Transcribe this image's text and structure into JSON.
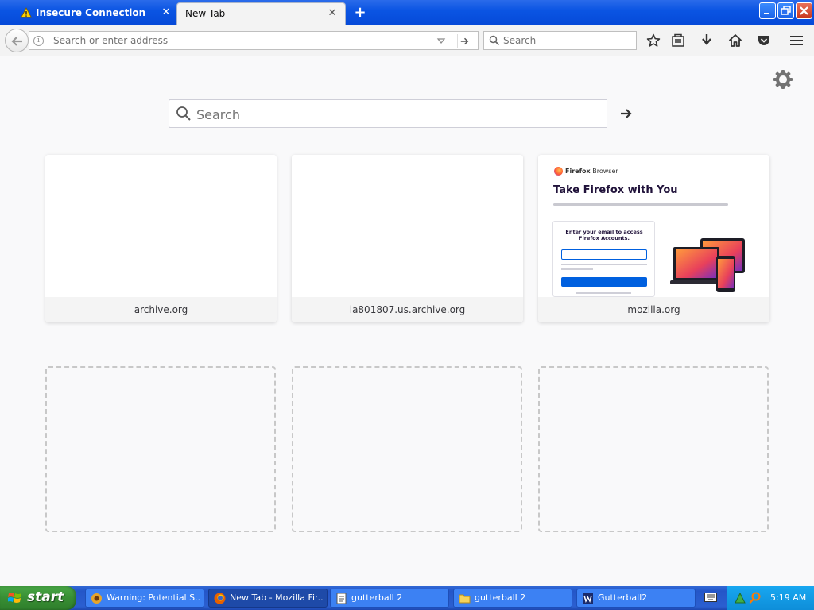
{
  "browser": {
    "tabs": [
      {
        "label": "Insecure Connection",
        "icon": "warning-icon",
        "active": false
      },
      {
        "label": "New Tab",
        "active": true
      }
    ],
    "new_tab_icon": "plus-icon",
    "window_controls": [
      "minimize-icon",
      "restore-icon",
      "close-icon"
    ],
    "urlbar": {
      "placeholder": "Search or enter address",
      "value": ""
    },
    "searchbar": {
      "placeholder": "Search"
    },
    "toolbar_icons": [
      "bookmark-star-icon",
      "library-icon",
      "download-icon",
      "home-icon",
      "pocket-icon",
      "menu-icon"
    ]
  },
  "newtab": {
    "search_placeholder": "Search",
    "settings_icon": "gear-icon",
    "top_sites": [
      {
        "label": "archive.org"
      },
      {
        "label": "ia801807.us.archive.org"
      },
      {
        "label": "mozilla.org"
      }
    ],
    "empty_slots": 3,
    "preview": {
      "brand_bold": "Firefox",
      "brand_rest": "Browser",
      "title": "Take Firefox with You",
      "card_heading": "Enter your email to access Firefox Accounts."
    }
  },
  "taskbar": {
    "start_label": "start",
    "tasks": [
      {
        "label": "Warning: Potential S...",
        "icon": "warning-app-icon",
        "active": false
      },
      {
        "label": "New Tab - Mozilla Fir...",
        "icon": "firefox-icon",
        "active": true
      },
      {
        "label": "gutterball 2",
        "icon": "notepad-icon",
        "active": false
      },
      {
        "label": "gutterball 2",
        "icon": "folder-icon",
        "active": false
      },
      {
        "label": "Gutterball2",
        "icon": "game-icon",
        "active": false
      }
    ],
    "clock": "5:19 AM"
  },
  "colors": {
    "titlebar": "#0b55e3",
    "taskbar": "#2456c8",
    "start": "#388e34",
    "tray": "#0e8ed9"
  }
}
